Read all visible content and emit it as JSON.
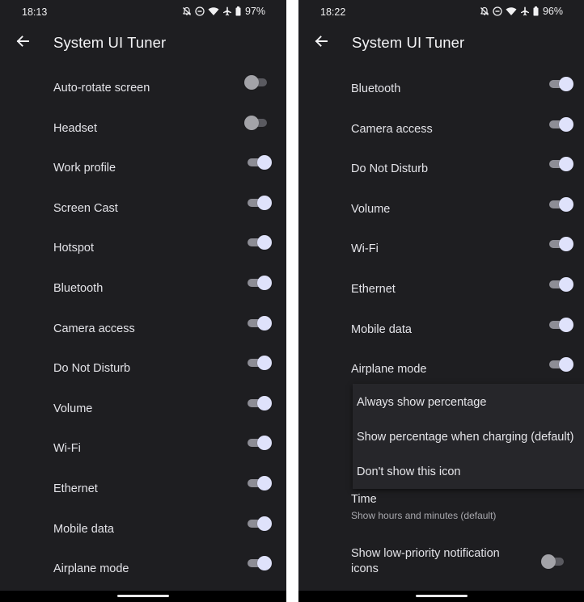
{
  "left": {
    "status": {
      "time": "18:13",
      "battery": "97%"
    },
    "title": "System UI Tuner",
    "toggles": [
      {
        "label": "Auto-rotate screen",
        "on": false
      },
      {
        "label": "Headset",
        "on": false
      },
      {
        "label": "Work profile",
        "on": true
      },
      {
        "label": "Screen Cast",
        "on": true
      },
      {
        "label": "Hotspot",
        "on": true
      },
      {
        "label": "Bluetooth",
        "on": true
      },
      {
        "label": "Camera access",
        "on": true
      },
      {
        "label": "Do Not Disturb",
        "on": true
      },
      {
        "label": "Volume",
        "on": true
      },
      {
        "label": "Wi-Fi",
        "on": true
      },
      {
        "label": "Ethernet",
        "on": true
      },
      {
        "label": "Mobile data",
        "on": true
      },
      {
        "label": "Airplane mode",
        "on": true
      }
    ]
  },
  "right": {
    "status": {
      "time": "18:22",
      "battery": "96%"
    },
    "title": "System UI Tuner",
    "toggles": [
      {
        "label": "Bluetooth",
        "on": true
      },
      {
        "label": "Camera access",
        "on": true
      },
      {
        "label": "Do Not Disturb",
        "on": true
      },
      {
        "label": "Volume",
        "on": true
      },
      {
        "label": "Wi-Fi",
        "on": true
      },
      {
        "label": "Ethernet",
        "on": true
      },
      {
        "label": "Mobile data",
        "on": true
      },
      {
        "label": "Airplane mode",
        "on": true
      }
    ],
    "battery_menu": [
      "Always show percentage",
      "Show percentage when charging (default)",
      "Don't show this icon"
    ],
    "time_pref": {
      "title": "Time",
      "summary": "Show hours and minutes (default)"
    },
    "low_priority": {
      "label": "Show low-priority notification icons",
      "on": false
    }
  },
  "colors": {
    "background": "#1e1e21",
    "switch_on_thumb": "#dfe2fb",
    "switch_off_thumb": "#a3a3a8",
    "text": "#e3e3e8"
  },
  "icons": [
    "bell-off-icon",
    "do-not-disturb-icon",
    "wifi-icon",
    "airplane-icon",
    "battery-icon",
    "back-arrow-icon"
  ]
}
